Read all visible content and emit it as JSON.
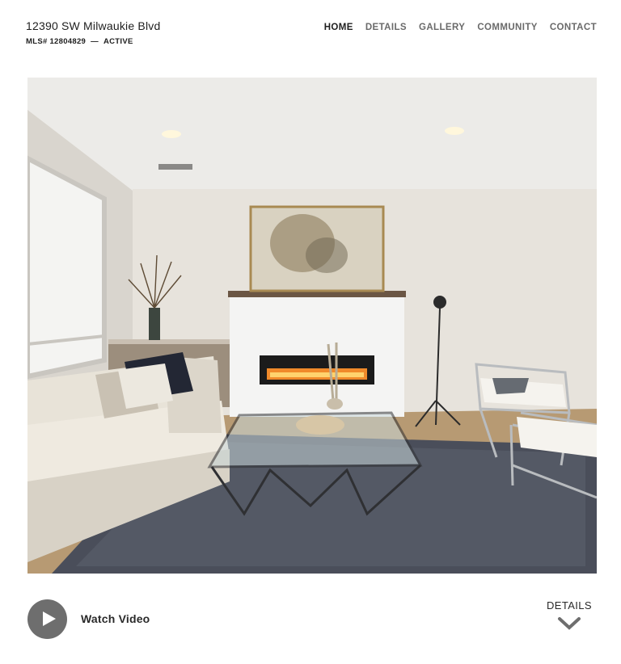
{
  "header": {
    "address": "12390 SW Milwaukie Blvd",
    "mls_label": "MLS# 12804829",
    "mls_separator": "—",
    "status": "ACTIVE"
  },
  "nav": {
    "items": [
      {
        "label": "HOME",
        "active": true
      },
      {
        "label": "DETAILS",
        "active": false
      },
      {
        "label": "GALLERY",
        "active": false
      },
      {
        "label": "COMMUNITY",
        "active": false
      },
      {
        "label": "CONTACT",
        "active": false
      }
    ]
  },
  "hero": {
    "image": "living-room-photo"
  },
  "video": {
    "label": "Watch Video",
    "icon": "play-icon"
  },
  "details_link": {
    "label": "DETAILS",
    "icon": "chevron-down-icon"
  },
  "colors": {
    "nav_active": "#1e1e1e",
    "nav_inactive": "#6a6a6a",
    "play_button": "#6e6e6e"
  }
}
